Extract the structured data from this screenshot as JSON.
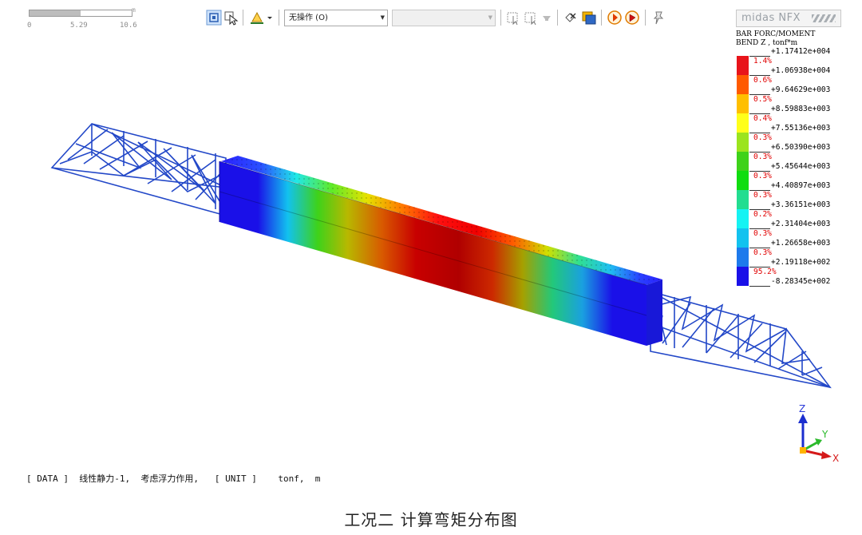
{
  "scale_bar": {
    "unit": "m",
    "ticks": [
      "0",
      "5.29",
      "10.6"
    ],
    "fill_fraction": 0.5
  },
  "toolbar": {
    "action_select": "无操作 (O)",
    "secondary_select": "",
    "icons": [
      "select-box-icon",
      "select-cursor-icon",
      "view-style-icon",
      "dropdown-arrow-icon",
      "pick-node-icon",
      "pick-element-icon",
      "filter-icon",
      "hide-icon",
      "display-icon",
      "snap-node-icon",
      "snap-point-icon",
      "pin-icon"
    ]
  },
  "legend": {
    "logo": "midas NFX",
    "title_line1": "BAR FORC/MOMENT",
    "title_line2": "BEND Z , tonf*m",
    "values": [
      "+1.17412e+004",
      "+1.06938e+004",
      "+9.64629e+003",
      "+8.59883e+003",
      "+7.55136e+003",
      "+6.50390e+003",
      "+5.45644e+003",
      "+4.40897e+003",
      "+3.36151e+003",
      "+2.31404e+003",
      "+1.26658e+003",
      "+2.19118e+002",
      "-8.28345e+002"
    ],
    "percents": [
      "1.4%",
      "0.6%",
      "0.5%",
      "0.4%",
      "0.3%",
      "0.3%",
      "0.3%",
      "0.3%",
      "0.2%",
      "0.3%",
      "0.3%",
      "95.2%"
    ],
    "colors": [
      "#e8141a",
      "#ff5a00",
      "#ffbf00",
      "#ffff1a",
      "#9be41e",
      "#3ed21a",
      "#10dd10",
      "#22dd90",
      "#15f3f3",
      "#12c2ef",
      "#1d7aec",
      "#1a10e8"
    ]
  },
  "axes": {
    "z": "Z",
    "y": "Y",
    "x": "X"
  },
  "status": {
    "data_tag": "[ DATA ]",
    "analysis": "线性静力-1,",
    "note": "考虑浮力作用,",
    "unit_tag": "[ UNIT ]",
    "unit_value": "tonf,  m"
  },
  "caption": "工况二  计算弯矩分布图"
}
